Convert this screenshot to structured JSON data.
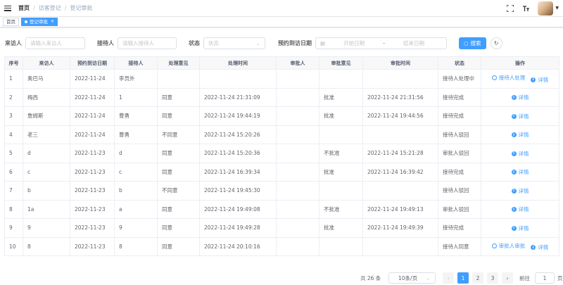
{
  "breadcrumb": [
    "首页",
    "访客登记",
    "登记审批"
  ],
  "header_icons": [
    "fullscreen-icon",
    "font-size-icon"
  ],
  "tags": [
    {
      "label": "首页",
      "active": false
    },
    {
      "label": "登记审批",
      "active": true
    }
  ],
  "search": {
    "visitor": {
      "label": "来访人",
      "placeholder": "请输入来访人"
    },
    "receiver": {
      "label": "接待人",
      "placeholder": "请输入接待人"
    },
    "status": {
      "label": "状态",
      "placeholder": "状态"
    },
    "date": {
      "label": "预约到访日期",
      "start_placeholder": "开始日期",
      "sep": "-",
      "end_placeholder": "结束日期"
    },
    "search_button": "搜索"
  },
  "table": {
    "columns": [
      "序号",
      "来访人",
      "预约到访日期",
      "接待人",
      "处理意见",
      "处理时间",
      "审批人",
      "审批意见",
      "审批时间",
      "状态",
      "操作"
    ],
    "rows": [
      [
        "1",
        "奥巴马",
        "2022-11-24",
        "李员外",
        "",
        "",
        "",
        "",
        "",
        "接待人处理中",
        ""
      ],
      [
        "2",
        "梅西",
        "2022-11-24",
        "1",
        "同意",
        "2022-11-24 21:31:09",
        "",
        "批准",
        "2022-11-24 21:31:56",
        "接待完成",
        ""
      ],
      [
        "3",
        "詹姆斯",
        "2022-11-24",
        "曹勇",
        "同意",
        "2022-11-24 19:44:19",
        "",
        "批准",
        "2022-11-24 19:44:56",
        "接待完成",
        ""
      ],
      [
        "4",
        "老三",
        "2022-11-24",
        "曹勇",
        "不同意",
        "2022-11-24 15:20:26",
        "",
        "",
        "",
        "接待人驳回",
        ""
      ],
      [
        "5",
        "d",
        "2022-11-23",
        "d",
        "同意",
        "2022-11-24 15:20:36",
        "",
        "不批准",
        "2022-11-24 15:21:28",
        "审批人驳回",
        ""
      ],
      [
        "6",
        "c",
        "2022-11-23",
        "c",
        "同意",
        "2022-11-24 16:39:34",
        "",
        "批准",
        "2022-11-24 16:39:42",
        "接待完成",
        ""
      ],
      [
        "7",
        "b",
        "2022-11-23",
        "b",
        "不同意",
        "2022-11-24 19:45:30",
        "",
        "",
        "",
        "接待人驳回",
        ""
      ],
      [
        "8",
        "1a",
        "2022-11-23",
        "a",
        "同意",
        "2022-11-24 19:49:08",
        "",
        "不批准",
        "2022-11-24 19:49:13",
        "审批人驳回",
        ""
      ],
      [
        "9",
        "9",
        "2022-11-23",
        "9",
        "同意",
        "2022-11-24 19:49:28",
        "",
        "批准",
        "2022-11-24 19:49:39",
        "接待完成",
        ""
      ],
      [
        "10",
        "8",
        "2022-11-23",
        "8",
        "同意",
        "2022-11-24 20:10:16",
        "",
        "",
        "",
        "接待人同意",
        ""
      ]
    ],
    "actions": [
      [
        "接待人处理",
        "详情"
      ],
      [
        "详情"
      ],
      [
        "详情"
      ],
      [
        "详情"
      ],
      [
        "详情"
      ],
      [
        "详情"
      ],
      [
        "详情"
      ],
      [
        "详情"
      ],
      [
        "详情"
      ],
      [
        "审批人审批",
        "详情"
      ]
    ]
  },
  "pagination": {
    "total": "共 26 条",
    "page_size": "10条/页",
    "pages": [
      "1",
      "2",
      "3"
    ],
    "current": "1",
    "prev": "‹",
    "next": "›",
    "goto_label": "前往",
    "goto_value": "1",
    "page_suffix": "页"
  }
}
